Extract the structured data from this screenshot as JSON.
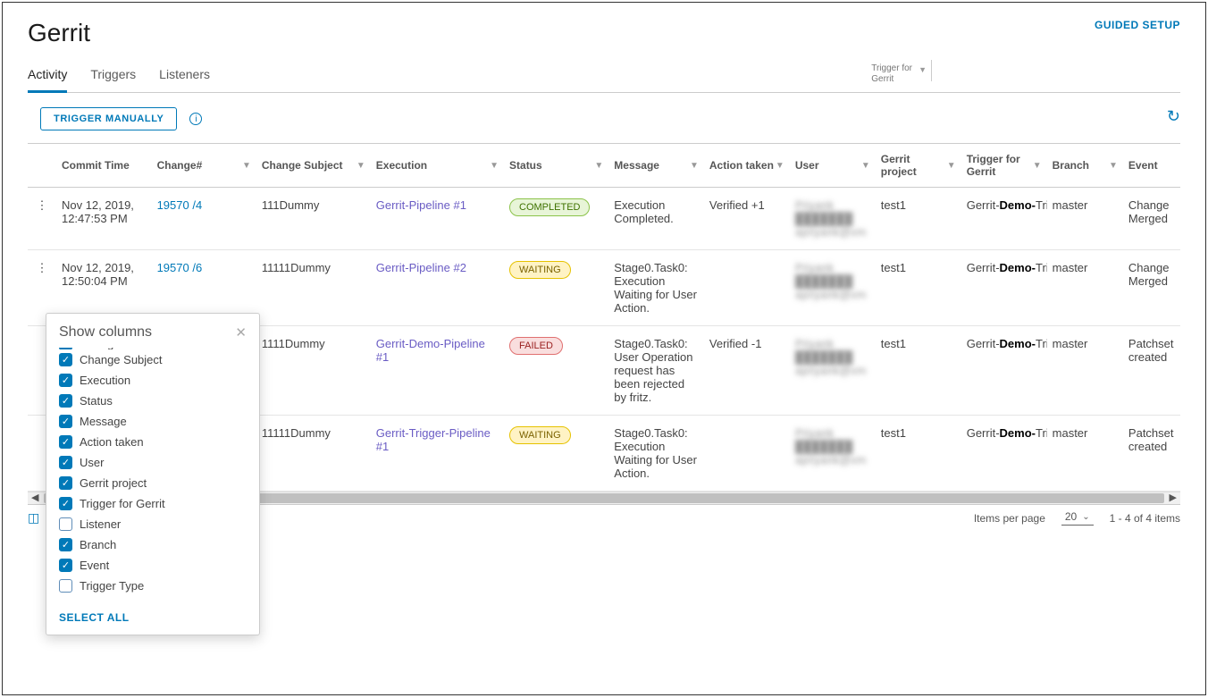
{
  "header": {
    "title": "Gerrit",
    "guided_setup": "GUIDED SETUP"
  },
  "tabs": {
    "activity": "Activity",
    "triggers": "Triggers",
    "listeners": "Listeners",
    "pill_line1": "Trigger for",
    "pill_line2": "Gerrit"
  },
  "actions": {
    "trigger_manually": "TRIGGER MANUALLY"
  },
  "columns": {
    "commit_time": "Commit Time",
    "change": "Change#",
    "change_subject": "Change Subject",
    "execution": "Execution",
    "status": "Status",
    "message": "Message",
    "action_taken": "Action taken",
    "user": "User",
    "gerrit_project": "Gerrit project",
    "trigger_for_gerrit": "Trigger for Gerrit",
    "branch": "Branch",
    "event": "Event"
  },
  "status_labels": {
    "completed": "COMPLETED",
    "waiting": "WAITING",
    "failed": "FAILED"
  },
  "rows": [
    {
      "commit_time": "Nov 12, 2019, 12:47:53 PM",
      "change": "19570 /4",
      "subject": "111Dummy",
      "execution": "Gerrit-Pipeline #1",
      "status": "completed",
      "message": "Execution Completed.",
      "action_taken": "Verified +1",
      "user_redacted": "Priyank ███████ apriyank@vm",
      "project": "test1",
      "trigger_prefix": "Gerrit-",
      "trigger_bold": "Demo-",
      "trigger_suffix": "Trigger",
      "branch": "master",
      "event": "Change Merged"
    },
    {
      "commit_time": "Nov 12, 2019, 12:50:04 PM",
      "change": "19570 /6",
      "subject": "11111Dummy",
      "execution": "Gerrit-Pipeline #2",
      "status": "waiting",
      "message": "Stage0.Task0: Execution Waiting for User Action.",
      "action_taken": "",
      "user_redacted": "Priyank ███████ apriyank@vm",
      "project": "test1",
      "trigger_prefix": "Gerrit-",
      "trigger_bold": "Demo-",
      "trigger_suffix": "Trigger",
      "branch": "master",
      "event": "Change Merged"
    },
    {
      "commit_time": "",
      "change": "",
      "subject": "1111Dummy",
      "execution": "Gerrit-Demo-Pipeline #1",
      "status": "failed",
      "message": "Stage0.Task0: User Operation request has been rejected by fritz.",
      "action_taken": "Verified -1",
      "user_redacted": "Priyank ███████ apriyank@vm",
      "project": "test1",
      "trigger_prefix": "Gerrit-",
      "trigger_bold": "Demo-",
      "trigger_suffix": "Trigger",
      "branch": "master",
      "event": "Patchset created"
    },
    {
      "commit_time": "",
      "change": "",
      "subject": "11111Dummy",
      "execution": "Gerrit-Trigger-Pipeline #1",
      "status": "waiting",
      "message": "Stage0.Task0: Execution Waiting for User Action.",
      "action_taken": "",
      "user_redacted": "Priyank ███████ apriyank@vm",
      "project": "test1",
      "trigger_prefix": "Gerrit-",
      "trigger_bold": "Demo-",
      "trigger_suffix": "Trigger",
      "branch": "master",
      "event": "Patchset created"
    }
  ],
  "popover": {
    "title": "Show columns",
    "select_all": "SELECT ALL",
    "items": [
      {
        "label": "Change#",
        "checked": true
      },
      {
        "label": "Change Subject",
        "checked": true
      },
      {
        "label": "Execution",
        "checked": true
      },
      {
        "label": "Status",
        "checked": true
      },
      {
        "label": "Message",
        "checked": true
      },
      {
        "label": "Action taken",
        "checked": true
      },
      {
        "label": "User",
        "checked": true
      },
      {
        "label": "Gerrit project",
        "checked": true
      },
      {
        "label": "Trigger for Gerrit",
        "checked": true
      },
      {
        "label": "Listener",
        "checked": false
      },
      {
        "label": "Branch",
        "checked": true
      },
      {
        "label": "Event",
        "checked": true
      },
      {
        "label": "Trigger Type",
        "checked": false
      }
    ]
  },
  "pagination": {
    "items_per_page": "Items per page",
    "page_size": "20",
    "range": "1 - 4 of 4 items"
  }
}
